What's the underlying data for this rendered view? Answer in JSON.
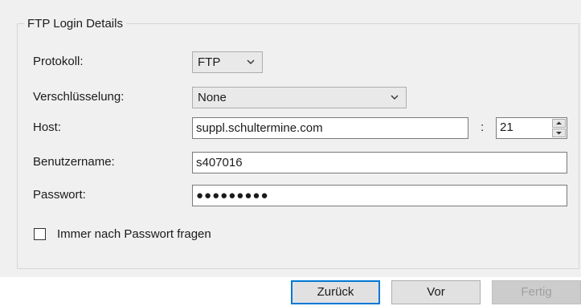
{
  "group": {
    "title": "FTP Login Details"
  },
  "protocol": {
    "label": "Protokoll:",
    "value": "FTP"
  },
  "encryption": {
    "label": "Verschlüsselung:",
    "value": "None"
  },
  "host": {
    "label": "Host:",
    "value": "suppl.schultermine.com",
    "port_separator": ":",
    "port": "21"
  },
  "username": {
    "label": "Benutzername:",
    "value": "s407016"
  },
  "password": {
    "label": "Passwort:",
    "value": "●●●●●●●●●"
  },
  "always_ask": {
    "label": "Immer nach Passwort fragen",
    "checked": false
  },
  "buttons": {
    "back": "Zurück",
    "next": "Vor",
    "finish": "Fertig"
  },
  "icons": {
    "dropdown": "chevron-down-icon",
    "spin_up": "arrow-up-icon",
    "spin_down": "arrow-down-icon"
  },
  "colors": {
    "accent": "#0078d7",
    "panel_bg": "#f0f0f0"
  }
}
